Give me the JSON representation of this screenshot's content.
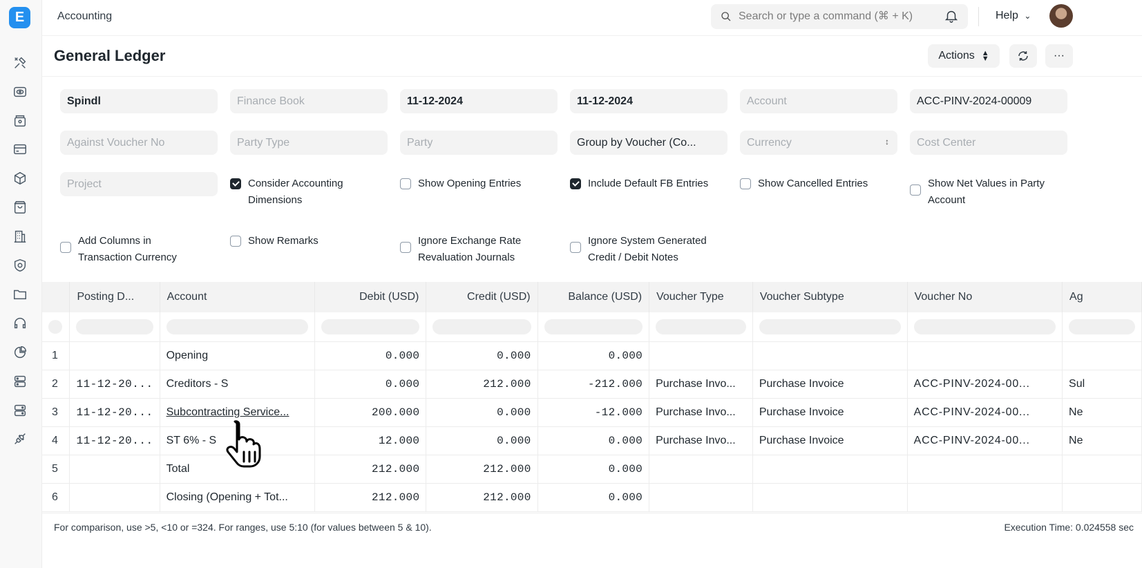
{
  "app": {
    "logo_letter": "E",
    "breadcrumb": "Accounting"
  },
  "navbar": {
    "search_placeholder": "Search or type a command (⌘ + K)",
    "help_label": "Help"
  },
  "sidebar": {
    "icons": [
      "tools-icon",
      "eye-icon",
      "storage-box-icon",
      "card-icon",
      "cube-icon",
      "shopping-bag-icon",
      "building-icon",
      "shield-icon",
      "folder-icon",
      "headset-icon",
      "pie-chart-icon",
      "server-icon",
      "database-icon",
      "plug-icon"
    ]
  },
  "page": {
    "title": "General Ledger",
    "actions_label": "Actions",
    "more_label": "···"
  },
  "filters": {
    "company": "Spindl",
    "finance_book_placeholder": "Finance Book",
    "from_date": "11-12-2024",
    "to_date": "11-12-2024",
    "account_placeholder": "Account",
    "voucher_no": "ACC-PINV-2024-00009",
    "against_voucher_placeholder": "Against Voucher No",
    "party_type_placeholder": "Party Type",
    "party_placeholder": "Party",
    "group_by": "Group by Voucher (Co...",
    "currency_placeholder": "Currency",
    "cost_center_placeholder": "Cost Center",
    "project_placeholder": "Project"
  },
  "checkboxes": {
    "consider_dimensions": {
      "line1": "Consider Accounting",
      "line2": "Dimensions",
      "checked": true
    },
    "show_opening": {
      "line1": "Show Opening Entries",
      "checked": false
    },
    "include_default_fb": {
      "line1": "Include Default FB Entries",
      "checked": true
    },
    "show_cancelled": {
      "line1": "Show Cancelled Entries",
      "checked": false
    },
    "show_net_values": {
      "line1": "Show Net Values in Party",
      "line2": "Account",
      "checked": false
    },
    "add_columns": {
      "line1": "Add Columns in",
      "line2": "Transaction Currency",
      "checked": false
    },
    "show_remarks": {
      "line1": "Show Remarks",
      "checked": false
    },
    "ignore_exchange": {
      "line1": "Ignore Exchange Rate",
      "line2": "Revaluation Journals",
      "checked": false
    },
    "ignore_system": {
      "line1": "Ignore System Generated",
      "line2": "Credit / Debit Notes",
      "checked": false
    }
  },
  "table": {
    "columns": [
      "Posting D...",
      "Account",
      "Debit (USD)",
      "Credit (USD)",
      "Balance (USD)",
      "Voucher Type",
      "Voucher Subtype",
      "Voucher No",
      "Ag"
    ],
    "rows": [
      {
        "idx": "1",
        "date": "",
        "account": "Opening",
        "debit": "0.000",
        "credit": "0.000",
        "balance": "0.000",
        "vtype": "",
        "vsub": "",
        "vno": "",
        "ag": ""
      },
      {
        "idx": "2",
        "date": "11-12-20...",
        "account": "Creditors - S",
        "debit": "0.000",
        "credit": "212.000",
        "balance": "-212.000",
        "vtype": "Purchase Invo...",
        "vsub": "Purchase Invoice",
        "vno": "ACC-PINV-2024-00...",
        "ag": "Sul"
      },
      {
        "idx": "3",
        "date": "11-12-20...",
        "account": "Subcontracting Service...",
        "debit": "200.000",
        "credit": "0.000",
        "balance": "-12.000",
        "vtype": "Purchase Invo...",
        "vsub": "Purchase Invoice",
        "vno": "ACC-PINV-2024-00...",
        "ag": "Ne"
      },
      {
        "idx": "4",
        "date": "11-12-20...",
        "account": "ST 6% - S",
        "debit": "12.000",
        "credit": "0.000",
        "balance": "0.000",
        "vtype": "Purchase Invo...",
        "vsub": "Purchase Invoice",
        "vno": "ACC-PINV-2024-00...",
        "ag": "Ne"
      },
      {
        "idx": "5",
        "date": "",
        "account": "Total",
        "debit": "212.000",
        "credit": "212.000",
        "balance": "0.000",
        "vtype": "",
        "vsub": "",
        "vno": "",
        "ag": ""
      },
      {
        "idx": "6",
        "date": "",
        "account": "Closing (Opening + Tot...",
        "debit": "212.000",
        "credit": "212.000",
        "balance": "0.000",
        "vtype": "",
        "vsub": "",
        "vno": "",
        "ag": ""
      }
    ]
  },
  "footer": {
    "hint": "For comparison, use >5, <10 or =324. For ranges, use 5:10 (for values between 5 & 10).",
    "execution_time": "Execution Time: 0.024558 sec"
  }
}
